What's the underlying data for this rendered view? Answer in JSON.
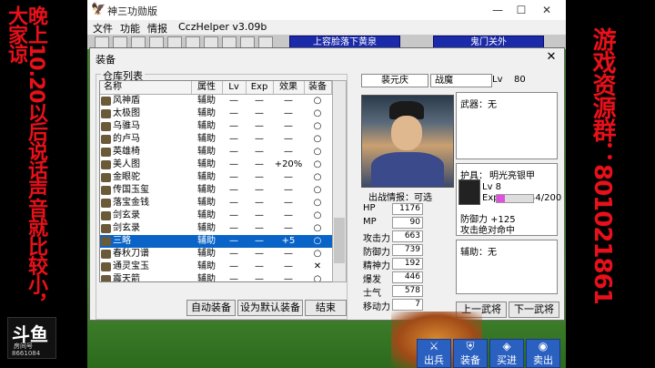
{
  "overlay": {
    "left_text": "晚上10.20以后说话声音就比较小，大家谅",
    "right_text": "游戏资源群：801021861",
    "logo_main": "斗鱼",
    "logo_sub": "房间号",
    "logo_num": "8661084"
  },
  "window": {
    "title": "神三功勋版",
    "min_label": "—",
    "max_label": "☐",
    "close_label": "✕"
  },
  "menu": [
    "文件",
    "功能",
    "情报",
    "CczHelper v3.09b"
  ],
  "toolbar": {
    "blue1": "上容脸落下黄泉",
    "blue2": "鬼门关外"
  },
  "dialog": {
    "title": "装备",
    "close": "✕",
    "group_label": "仓库列表",
    "columns": [
      "名称",
      "属性",
      "Lv",
      "Exp",
      "效果",
      "装备"
    ],
    "rows": [
      {
        "name": "风神盾",
        "attr": "辅助",
        "lv": "—",
        "exp": "—",
        "eff": "—",
        "eq": "○"
      },
      {
        "name": "太极图",
        "attr": "辅助",
        "lv": "—",
        "exp": "—",
        "eff": "—",
        "eq": "○"
      },
      {
        "name": "乌骓马",
        "attr": "辅助",
        "lv": "—",
        "exp": "—",
        "eff": "—",
        "eq": "○"
      },
      {
        "name": "的卢马",
        "attr": "辅助",
        "lv": "—",
        "exp": "—",
        "eff": "—",
        "eq": "○"
      },
      {
        "name": "英雄椅",
        "attr": "辅助",
        "lv": "—",
        "exp": "—",
        "eff": "—",
        "eq": "○"
      },
      {
        "name": "美人图",
        "attr": "辅助",
        "lv": "—",
        "exp": "—",
        "eff": "+20%",
        "eq": "○"
      },
      {
        "name": "金眼驼",
        "attr": "辅助",
        "lv": "—",
        "exp": "—",
        "eff": "—",
        "eq": "○"
      },
      {
        "name": "传国玉玺",
        "attr": "辅助",
        "lv": "—",
        "exp": "—",
        "eff": "—",
        "eq": "○"
      },
      {
        "name": "落宝金钱",
        "attr": "辅助",
        "lv": "—",
        "exp": "—",
        "eff": "—",
        "eq": "○"
      },
      {
        "name": "剑玄录",
        "attr": "辅助",
        "lv": "—",
        "exp": "—",
        "eff": "—",
        "eq": "○"
      },
      {
        "name": "剑玄录",
        "attr": "辅助",
        "lv": "—",
        "exp": "—",
        "eff": "—",
        "eq": "○"
      },
      {
        "name": "三略",
        "attr": "辅助",
        "lv": "—",
        "exp": "—",
        "eff": "+5",
        "eq": "○"
      },
      {
        "name": "春秋刀谱",
        "attr": "辅助",
        "lv": "—",
        "exp": "—",
        "eff": "—",
        "eq": "○"
      },
      {
        "name": "通灵宝玉",
        "attr": "辅助",
        "lv": "—",
        "exp": "—",
        "eff": "—",
        "eq": "✕"
      },
      {
        "name": "震天箭",
        "attr": "辅助",
        "lv": "—",
        "exp": "—",
        "eff": "—",
        "eq": "○"
      }
    ],
    "buttons": {
      "auto": "自动装备",
      "default": "设为默认装备",
      "end": "结束"
    }
  },
  "general": {
    "name": "裴元庆",
    "class": "战魔",
    "lv_label": "Lv",
    "lv": "80",
    "battle_info_label": "出战情报：可选",
    "stats": [
      {
        "label": "HP",
        "value": "1176"
      },
      {
        "label": "MP",
        "value": "90"
      },
      {
        "label": "攻击力",
        "value": "663"
      },
      {
        "label": "防御力",
        "value": "739"
      },
      {
        "label": "精神力",
        "value": "192"
      },
      {
        "label": "爆发",
        "value": "446"
      },
      {
        "label": "士气",
        "value": "578"
      },
      {
        "label": "移动力",
        "value": "7"
      }
    ],
    "weapon_label": "武器：无",
    "armor_label": "护具：",
    "armor_name": "明光亮银甲",
    "armor_lv": "Lv  8",
    "armor_exp_label": "Exp",
    "armor_exp": "44/200",
    "armor_exp_fraction": 0.22,
    "armor_def": "防御力 +125",
    "armor_effect": "攻击绝对命中",
    "assist_label": "辅助：无",
    "prev": "上一武将",
    "next": "下一武将"
  },
  "game_buttons": [
    "出兵",
    "装备",
    "买进",
    "卖出"
  ]
}
